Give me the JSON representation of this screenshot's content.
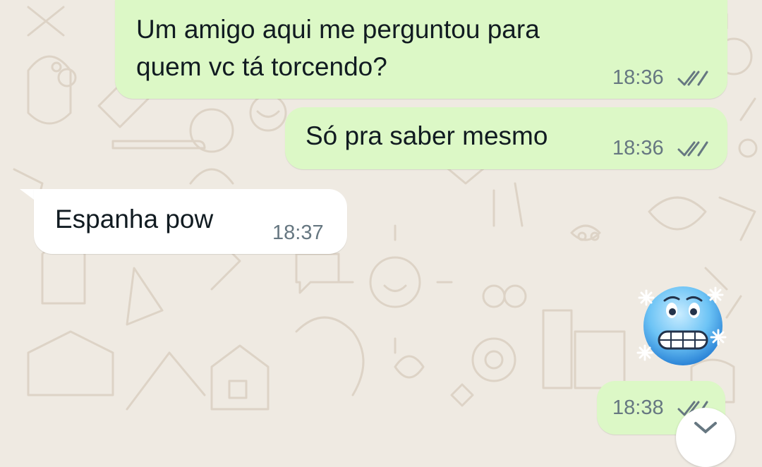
{
  "messages": [
    {
      "direction": "outgoing",
      "text": "Um amigo aqui me perguntou para quem vc tá torcendo?",
      "line1": "Um amigo aqui me perguntou para",
      "line2": "quem vc tá torcendo?",
      "time": "18:36",
      "status": "read"
    },
    {
      "direction": "outgoing",
      "text": "Só pra saber mesmo",
      "time": "18:36",
      "status": "read"
    },
    {
      "direction": "incoming",
      "text": "Espanha pow",
      "time": "18:37"
    },
    {
      "direction": "outgoing",
      "emoji": "cold-face",
      "time": "18:38",
      "status": "read"
    }
  ],
  "icons": {
    "read_receipt": "double-check-icon",
    "scroll_down": "chevron-down-icon",
    "emoji": "cold-face-emoji"
  },
  "colors": {
    "background": "#efeae2",
    "outgoing_bubble": "#dcf8c6",
    "incoming_bubble": "#ffffff",
    "text": "#111b21",
    "meta": "#667781"
  }
}
